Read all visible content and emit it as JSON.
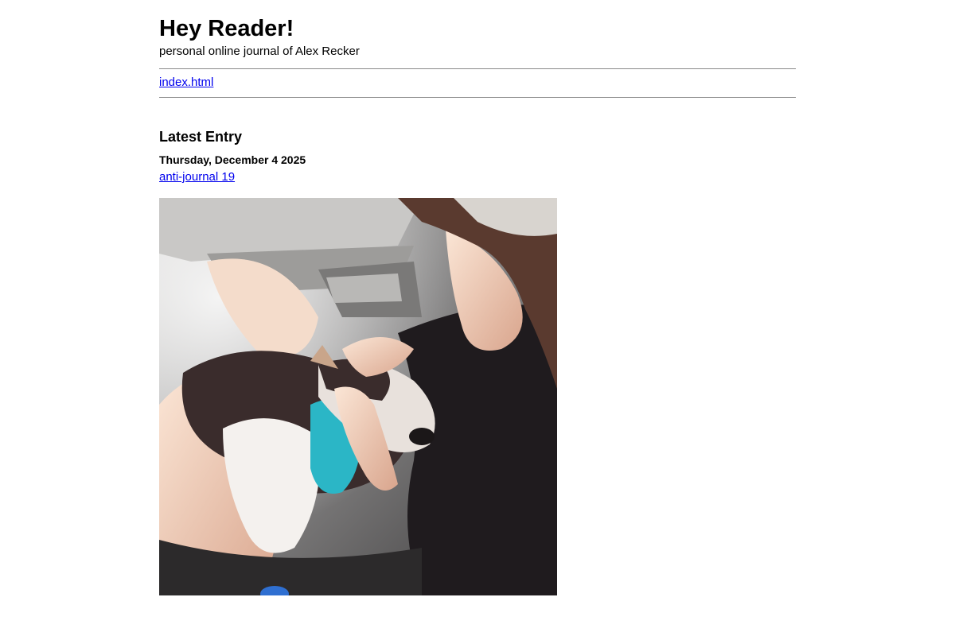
{
  "site": {
    "title": "Hey Reader!",
    "subtitle": "personal online journal of Alex Recker"
  },
  "nav": {
    "links": [
      {
        "label": "index.html"
      }
    ]
  },
  "latest": {
    "heading": "Latest Entry",
    "date": "Thursday, December 4 2025",
    "entry_link": "anti-journal 19"
  },
  "colors": {
    "link": "#0000ee",
    "rule": "#8a8a8a",
    "harness": "#2bb6c6"
  }
}
